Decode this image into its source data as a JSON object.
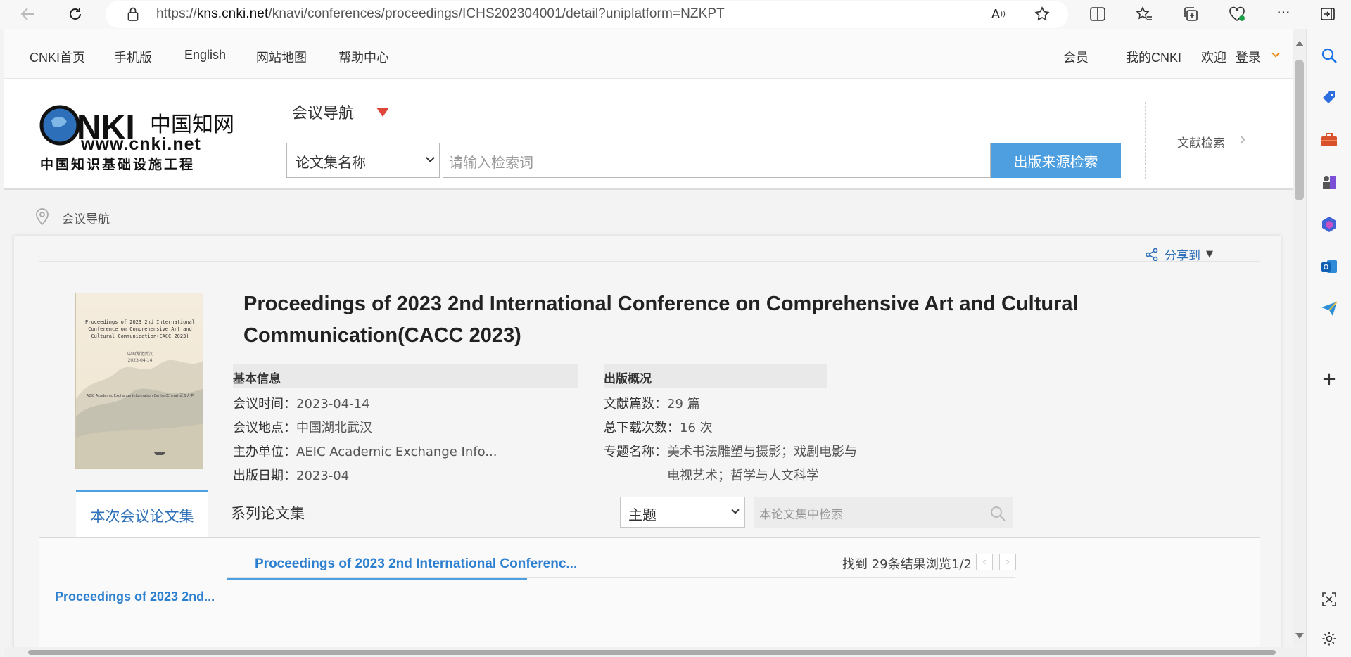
{
  "browser": {
    "url_prefix": "https://",
    "url_host": "kns.cnki.net",
    "url_path": "/knavi/conferences/proceedings/ICHS202304001/detail?uniplatform=NZKPT"
  },
  "topnav": {
    "items": [
      "CNKI首页",
      "手机版",
      "English",
      "网站地图",
      "帮助中心"
    ],
    "member": "会员",
    "my_cnki": "我的CNKI",
    "welcome": "欢迎",
    "login": "登录"
  },
  "header": {
    "logo_text_main": "CNKI中国知网",
    "logo_url": "www.cnki.net",
    "logo_sub": "中国知识基础设施工程",
    "conf_nav": "会议导航",
    "select_value": "论文集名称",
    "search_placeholder": "请输入检索词",
    "search_button": "出版来源检索",
    "lit_search": "文献检索"
  },
  "breadcrumb": {
    "text": "会议导航"
  },
  "share": {
    "label": "分享到"
  },
  "cover": {
    "title": "Proceedings of 2023 2nd International Conference on Comprehensive Art and Cultural Communication(CACC 2023)",
    "place": "中国湖北武汉",
    "date": "2023-04-14",
    "publisher": "AEIC Academic Exchange Information Center(China);武汉大学"
  },
  "proceedings": {
    "title": "Proceedings of 2023 2nd International Conference on Comprehensive Art and Cultural Communication(CACC 2023)",
    "basic_info": {
      "heading": "基本信息",
      "time_label": "会议时间：",
      "time_value": "2023-04-14",
      "place_label": "会议地点：",
      "place_value": "中国湖北武汉",
      "host_label": "主办单位：",
      "host_value": "AEIC Academic Exchange Info...",
      "pubdate_label": "出版日期：",
      "pubdate_value": "2023-04"
    },
    "pub_overview": {
      "heading": "出版概况",
      "count_label": "文献篇数：",
      "count_value": "29 篇",
      "downloads_label": "总下载次数：",
      "downloads_value": "16 次",
      "topic_label": "专题名称：",
      "topic_value_1": "美术书法雕塑与摄影；戏剧电影与",
      "topic_value_2": "电视艺术；哲学与人文科学"
    }
  },
  "tabs": {
    "current": "本次会议论文集",
    "series": "系列论文集"
  },
  "filter": {
    "topic_select": "主题",
    "within_placeholder": "本论文集中检索"
  },
  "results": {
    "sub_tab": "Proceedings of 2023 2nd International Conferenc...",
    "found": "找到 29条结果",
    "browse": "浏览1/2",
    "left_item": "Proceedings of 2023 2nd..."
  }
}
